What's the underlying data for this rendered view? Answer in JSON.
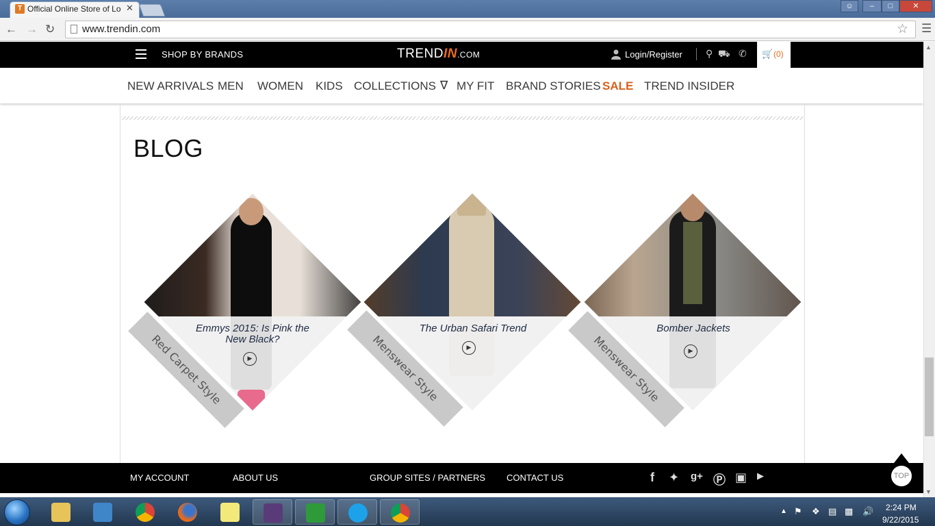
{
  "browser": {
    "tab_title": "Official Online Store of Lo",
    "tab_favicon": "T",
    "close_glyph": "✕",
    "url": "www.trendin.com",
    "icons": [
      "back-icon",
      "forward-icon",
      "reload-icon",
      "page-icon",
      "star-icon",
      "chrome-menu-icon"
    ]
  },
  "header": {
    "shop_by_brands": "SHOP BY BRANDS",
    "logo_trend": "TREND",
    "logo_in": "IN",
    "logo_com": ".COM",
    "login": "Login/Register",
    "cart_count": "(0)",
    "accent_color": "#ea6d1c"
  },
  "nav": {
    "items": [
      "NEW ARRIVALS",
      "MEN",
      "WOMEN",
      "KIDS",
      "COLLECTIONS",
      "MY FIT",
      "BRAND STORIES",
      "SALE",
      "TREND INSIDER"
    ]
  },
  "blog": {
    "heading": "BLOG",
    "posts": [
      {
        "title": "Emmys 2015: Is Pink the New Black?",
        "category": "Red Carpet Style"
      },
      {
        "title": "The Urban Safari Trend",
        "category": "Menswear Style"
      },
      {
        "title": "Bomber Jackets",
        "category": "Menswear Style"
      }
    ]
  },
  "footer": {
    "links": [
      "MY ACCOUNT",
      "ABOUT US",
      "GROUP SITES / PARTNERS",
      "CONTACT US"
    ],
    "social": [
      "facebook-icon",
      "twitter-icon",
      "google-plus-icon",
      "pinterest-icon",
      "instagram-icon",
      "youtube-icon"
    ],
    "top_label": "TOP"
  },
  "taskbar": {
    "time": "2:24 PM",
    "date": "9/22/2015",
    "apps": [
      "file-explorer",
      "media-player",
      "chrome",
      "firefox",
      "sticky-notes",
      "java-ee-ide",
      "spreadsheet",
      "skype",
      "chrome"
    ]
  }
}
